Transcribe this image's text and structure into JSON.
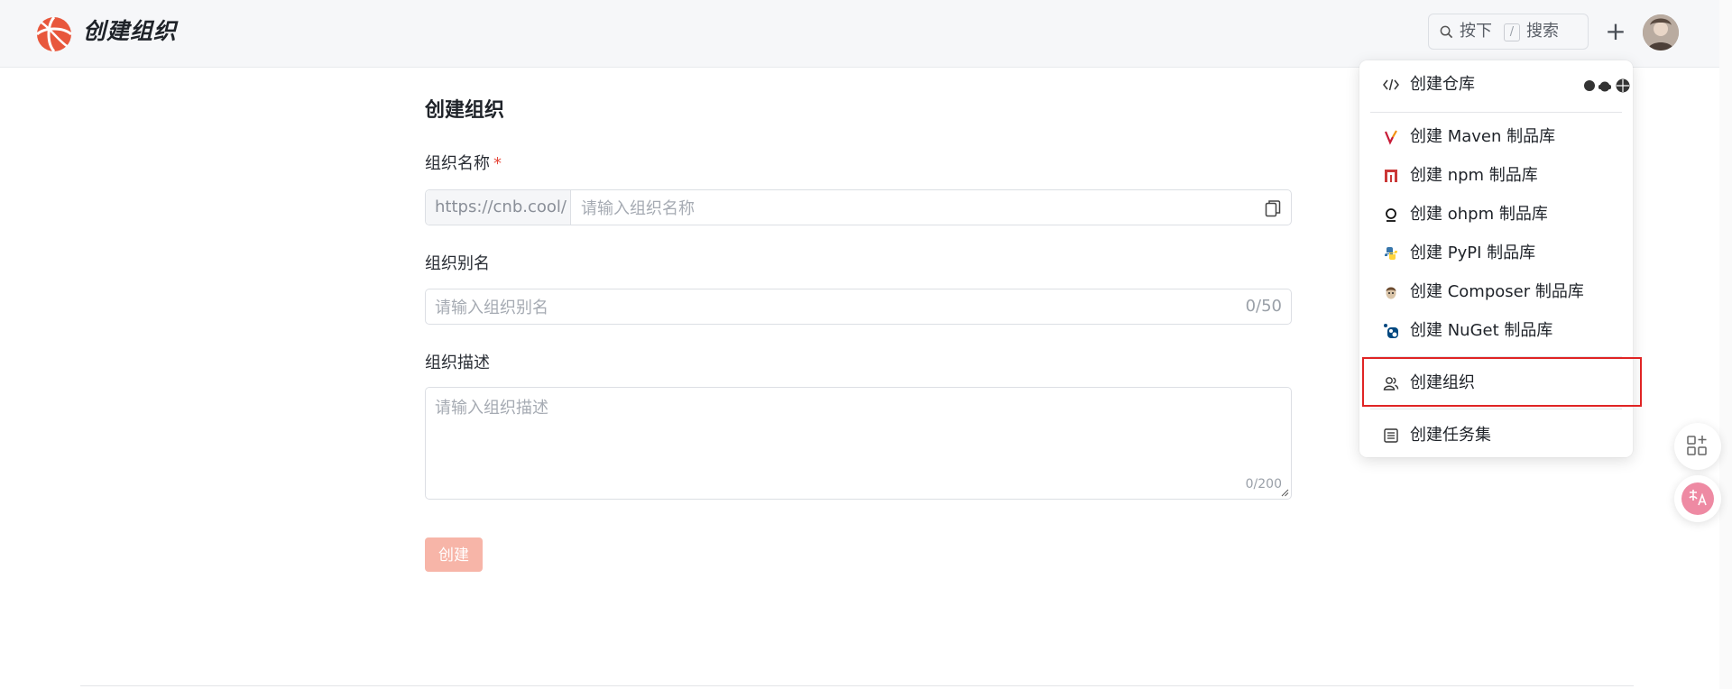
{
  "header": {
    "brand_title": "创建组织",
    "search_press": "按下",
    "search_key": "/",
    "search_label": "搜索",
    "plus_glyph": "+",
    "icons": {
      "logo": "cnb-logo-icon",
      "search": "search-icon",
      "avatar": "user-avatar"
    }
  },
  "form": {
    "page_title": "创建组织",
    "name_label": "组织名称",
    "required_mark": "*",
    "url_prefix": "https://cnb.cool/",
    "name_placeholder": "请输入组织名称",
    "alias_label": "组织别名",
    "alias_placeholder": "请输入组织别名",
    "alias_counter": "0/50",
    "desc_label": "组织描述",
    "desc_placeholder": "请输入组织描述",
    "desc_counter": "0/200",
    "submit_label": "创建"
  },
  "menu": {
    "create_repo": "创建仓库",
    "create_maven": "创建 Maven 制品库",
    "create_npm": "创建 npm 制品库",
    "create_ohpm": "创建 ohpm 制品库",
    "create_pypi": "创建 PyPI 制品库",
    "create_composer": "创建 Composer 制品库",
    "create_nuget": "创建 NuGet 制品库",
    "create_org": "创建组织",
    "create_taskset": "创建任务集"
  },
  "colors": {
    "brand": "#e8573c",
    "primary_disabled": "#f7b5a8",
    "highlight": "#e02424",
    "required": "#e5483b"
  }
}
